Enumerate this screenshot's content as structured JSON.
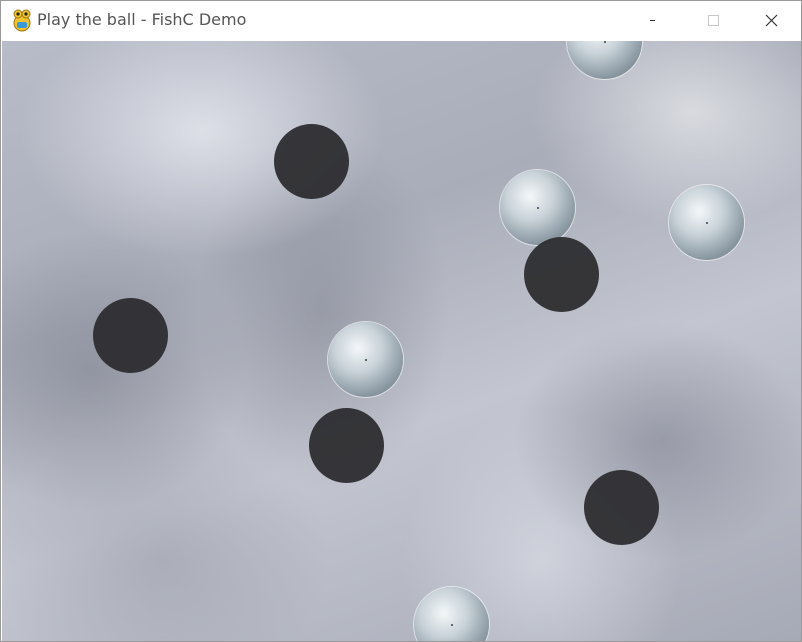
{
  "window": {
    "title": "Play the ball - FishC Demo",
    "app_icon": "pygame-snake-icon",
    "controls": [
      "minimize-icon",
      "maximize-icon",
      "close-icon"
    ]
  },
  "game": {
    "balls": [
      {
        "kind": "silver"
      },
      {
        "kind": "dark"
      },
      {
        "kind": "silver"
      },
      {
        "kind": "silver"
      },
      {
        "kind": "dark"
      },
      {
        "kind": "dark"
      },
      {
        "kind": "silver"
      },
      {
        "kind": "dark"
      },
      {
        "kind": "dark"
      },
      {
        "kind": "silver"
      }
    ]
  }
}
